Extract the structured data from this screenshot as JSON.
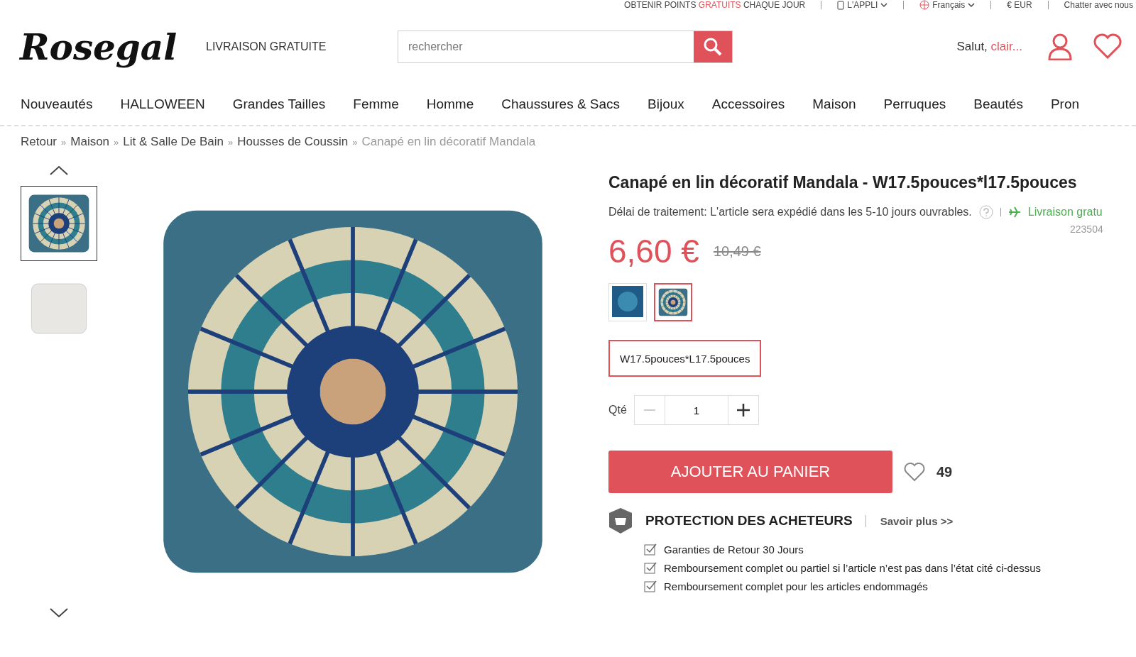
{
  "top_bar": {
    "points": {
      "before": "OBTENIR POINTS",
      "highlight": "GRATUITS",
      "after": "CHAQUE JOUR"
    },
    "app": "L'APPLI",
    "language": "Français",
    "currency": "€ EUR",
    "chat": "Chatter avec nous"
  },
  "header": {
    "logo": "Rosegal",
    "shipping": "LIVRAISON GRATUITE",
    "search": {
      "placeholder": "rechercher"
    },
    "greeting": "Salut,",
    "user": "clair..."
  },
  "nav": [
    "Nouveautés",
    "HALLOWEEN",
    "Grandes Tailles",
    "Femme",
    "Homme",
    "Chaussures & Sacs",
    "Bijoux",
    "Accessoires",
    "Maison",
    "Perruques",
    "Beautés",
    "Pron"
  ],
  "breadcrumb_separator": "»",
  "breadcrumb": [
    {
      "label": "Retour",
      "current": false
    },
    {
      "label": "Maison",
      "current": false
    },
    {
      "label": "Lit & Salle De Bain",
      "current": false
    },
    {
      "label": "Housses de Coussin",
      "current": false
    },
    {
      "label": "Canapé en lin décoratif Mandala",
      "current": true
    }
  ],
  "gallery": {
    "thumbnails": [
      {
        "kind": "mandala",
        "selected": true
      },
      {
        "kind": "plain",
        "selected": false
      }
    ]
  },
  "product": {
    "title": "Canapé en lin décoratif Mandala - W17.5pouces*l17.5pouces",
    "processing": "Délai de traitement: L'article sera expédié dans les 5-10 jours ouvrables.",
    "shipping": "Livraison gratu",
    "sku": "223504",
    "price": "6,60 €",
    "old_price": "10,49 €",
    "colors": [
      {
        "kind": "blue",
        "selected": false
      },
      {
        "kind": "mandala",
        "selected": true
      }
    ],
    "sizes": [
      {
        "label": "W17.5pouces*L17.5pouces",
        "selected": true
      }
    ],
    "qty_label": "Qté",
    "qty": "1",
    "add_to_cart": "AJOUTER AU PANIER",
    "likes": "49",
    "protection": {
      "title": "PROTECTION DES ACHETEURS",
      "link": "Savoir plus >>",
      "items": [
        "Garanties de Retour 30 Jours",
        "Remboursement complet ou partiel si l’article n’est pas dans l’état cité ci-dessus",
        "Remboursement complet pour les articles endommagés"
      ]
    }
  }
}
